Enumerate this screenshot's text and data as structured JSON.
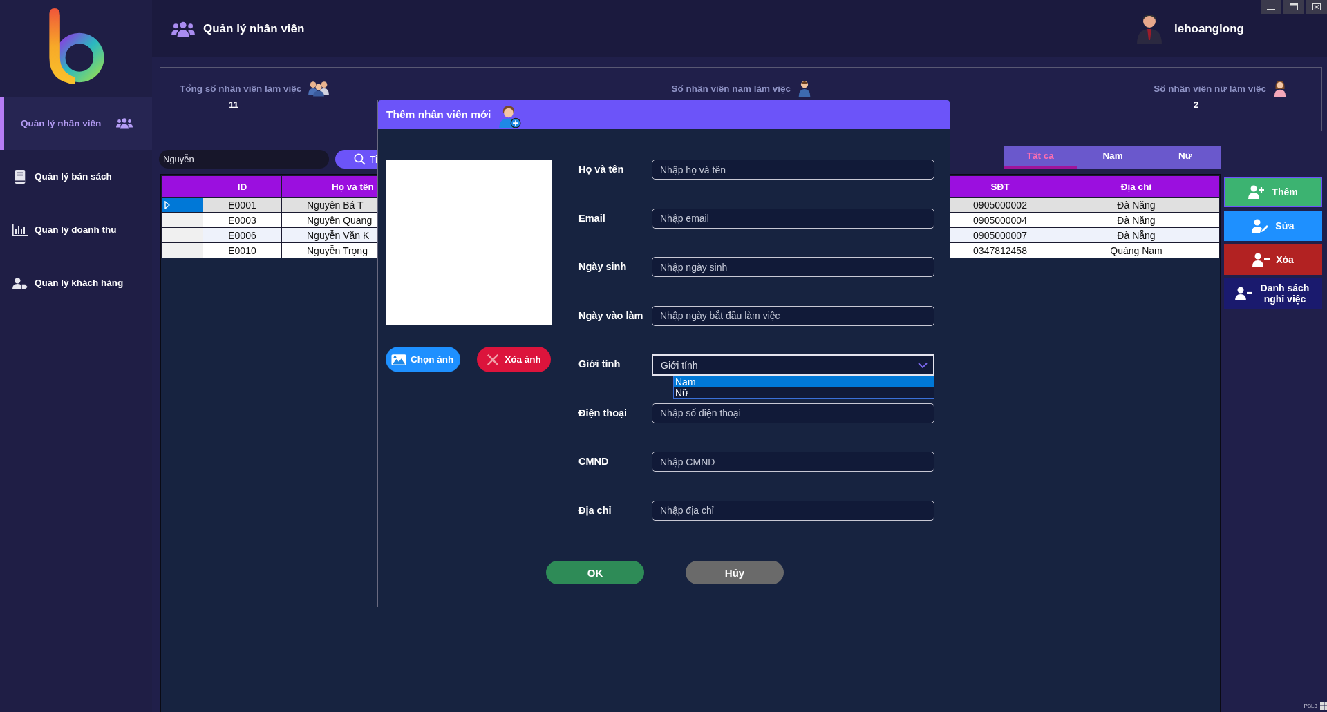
{
  "sidebar": {
    "items": [
      {
        "label": "Quản lý nhân viên",
        "selected": true
      },
      {
        "label": "Quản lý bán sách",
        "selected": false
      },
      {
        "label": "Quản lý doanh thu",
        "selected": false
      },
      {
        "label": "Quản lý khách hàng",
        "selected": false
      }
    ]
  },
  "header": {
    "title": "Quản lý nhân viên",
    "user": "lehoanglong"
  },
  "stats": [
    {
      "label": "Tổng số nhân viên làm việc",
      "value": "11"
    },
    {
      "label": "Số nhân viên nam làm việc"
    },
    {
      "label": "Số nhân viên nữ làm việc",
      "value": "2"
    }
  ],
  "search": {
    "value": "Nguyễn",
    "button": "Ti"
  },
  "filter_tabs": [
    {
      "label": "Tất cả",
      "selected": true
    },
    {
      "label": "Nam",
      "selected": false
    },
    {
      "label": "Nữ",
      "selected": false
    }
  ],
  "table": {
    "columns": [
      "ID",
      "Họ và tên",
      "SĐT",
      "Địa chỉ"
    ],
    "rows": [
      {
        "selected": true,
        "cells": [
          "E0001",
          "Nguyễn Bá T",
          "0905000002",
          "Đà Nẵng"
        ]
      },
      {
        "selected": false,
        "cells": [
          "E0003",
          "Nguyễn Quang",
          "0905000004",
          "Đà Nẵng"
        ]
      },
      {
        "selected": false,
        "cells": [
          "E0006",
          "Nguyễn Văn K",
          "0905000007",
          "Đà Nẵng"
        ]
      },
      {
        "selected": false,
        "cells": [
          "E0010",
          "Nguyễn Trọng",
          "0347812458",
          "Quảng Nam"
        ]
      }
    ]
  },
  "actions": [
    {
      "label": "Thêm",
      "kind": "add"
    },
    {
      "label": "Sửa",
      "kind": "edit"
    },
    {
      "label": "Xóa",
      "kind": "delete"
    },
    {
      "label": "Danh sách nghỉ việc",
      "kind": "resigned"
    }
  ],
  "dialog": {
    "title": "Thêm nhân viên mới",
    "photo_buttons": [
      {
        "label": "Chọn ảnh",
        "kind": "choose"
      },
      {
        "label": "Xóa ảnh",
        "kind": "remove"
      }
    ],
    "fields": [
      {
        "label": "Họ và tên",
        "kind": "text",
        "placeholder": "Nhập họ và tên"
      },
      {
        "label": "Email",
        "kind": "text",
        "placeholder": "Nhập email"
      },
      {
        "label": "Ngày sinh",
        "kind": "text",
        "placeholder": "Nhập ngày sinh"
      },
      {
        "label": "Ngày vào làm",
        "kind": "text",
        "placeholder": "Nhập ngày bắt đầu làm việc"
      },
      {
        "label": "Giới tính",
        "kind": "select",
        "value": "Giới tính",
        "expanded": true,
        "options": [
          {
            "label": "Nam",
            "selected": true
          },
          {
            "label": "Nữ",
            "selected": false
          }
        ]
      },
      {
        "label": "Điện thoại",
        "kind": "text",
        "placeholder": "Nhập số điện thoại"
      },
      {
        "label": "CMND",
        "kind": "text",
        "placeholder": "Nhập CMND"
      },
      {
        "label": "Địa chỉ",
        "kind": "text",
        "placeholder": "Nhập địa chỉ"
      }
    ],
    "buttons": [
      {
        "label": "OK",
        "kind": "ok"
      },
      {
        "label": "Hủy",
        "kind": "cancel"
      }
    ]
  },
  "footer": {
    "label": "PBL3"
  }
}
